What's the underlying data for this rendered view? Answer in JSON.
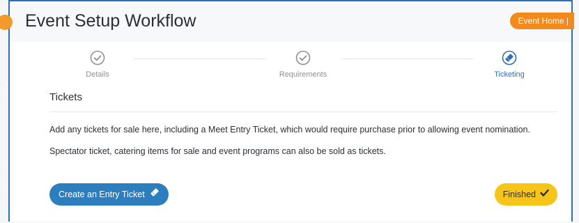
{
  "window": {
    "title": "Event Setup Workflow",
    "event_home_label": "Event Home |"
  },
  "stepper": {
    "steps": [
      {
        "label": "Details",
        "state": "complete",
        "icon": "check-circle-icon"
      },
      {
        "label": "Requirements",
        "state": "complete",
        "icon": "check-circle-icon"
      },
      {
        "label": "Ticketing",
        "state": "active",
        "icon": "ticket-circle-icon"
      }
    ]
  },
  "section": {
    "title": "Tickets",
    "paragraph_1": "Add any tickets for sale here, including a Meet Entry Ticket, which would require purchase prior to allowing event nomination.",
    "paragraph_2": "Spectator ticket, catering items for sale and event programs can also be sold as tickets."
  },
  "actions": {
    "create_entry_label": "Create an Entry Ticket",
    "create_entry_icon": "ticket-icon",
    "finished_label": "Finished",
    "finished_icon": "check-icon"
  },
  "colors": {
    "primary_blue": "#2d7ebf",
    "orange": "#f48a1c",
    "yellow": "#f7c519"
  }
}
